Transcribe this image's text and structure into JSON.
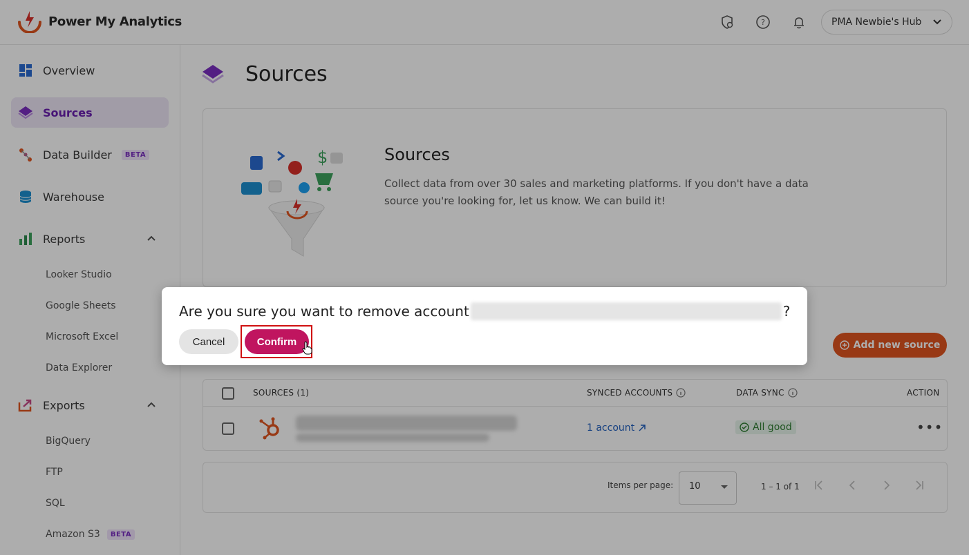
{
  "header": {
    "logo_text": "Power My Analytics",
    "hub_label": "PMA Newbie's Hub",
    "icons": [
      "shield-icon",
      "help-icon",
      "bell-icon"
    ]
  },
  "sidebar": {
    "items": [
      {
        "label": "Overview",
        "icon": "grid-icon"
      },
      {
        "label": "Sources",
        "icon": "layers-icon",
        "active": true
      },
      {
        "label": "Data Builder",
        "icon": "builder-icon",
        "badge": "BETA"
      },
      {
        "label": "Warehouse",
        "icon": "database-icon"
      },
      {
        "label": "Reports",
        "icon": "bar-chart-icon"
      },
      {
        "label": "Exports",
        "icon": "export-icon"
      }
    ],
    "reports_sub": [
      "Looker Studio",
      "Google Sheets",
      "Microsoft Excel",
      "Data Explorer"
    ],
    "exports_sub": [
      "BigQuery",
      "FTP",
      "SQL",
      "Amazon S3"
    ],
    "amazon_badge": "BETA"
  },
  "main": {
    "page_title": "Sources",
    "card_title": "Sources",
    "card_desc": "Collect data from over 30 sales and marketing platforms. If you don't have a data source you're looking for, let us know. We can build it!",
    "add_button": "Add new source",
    "table": {
      "headers": {
        "sources": "SOURCES (1)",
        "synced": "SYNCED ACCOUNTS",
        "data_sync": "DATA SYNC",
        "action": "ACTION"
      },
      "row": {
        "synced_link": "1 account",
        "status": "All good",
        "action": "•••"
      }
    },
    "pager": {
      "label": "Items per page:",
      "value": "10",
      "range": "1 – 1 of 1"
    }
  },
  "dialog": {
    "question": "Are you sure you want to remove account",
    "suffix": "?",
    "cancel": "Cancel",
    "confirm": "Confirm"
  },
  "colors": {
    "accent_purple": "#6a1fb0",
    "add_orange": "#e0541f",
    "confirm_magenta": "#c0155f"
  }
}
